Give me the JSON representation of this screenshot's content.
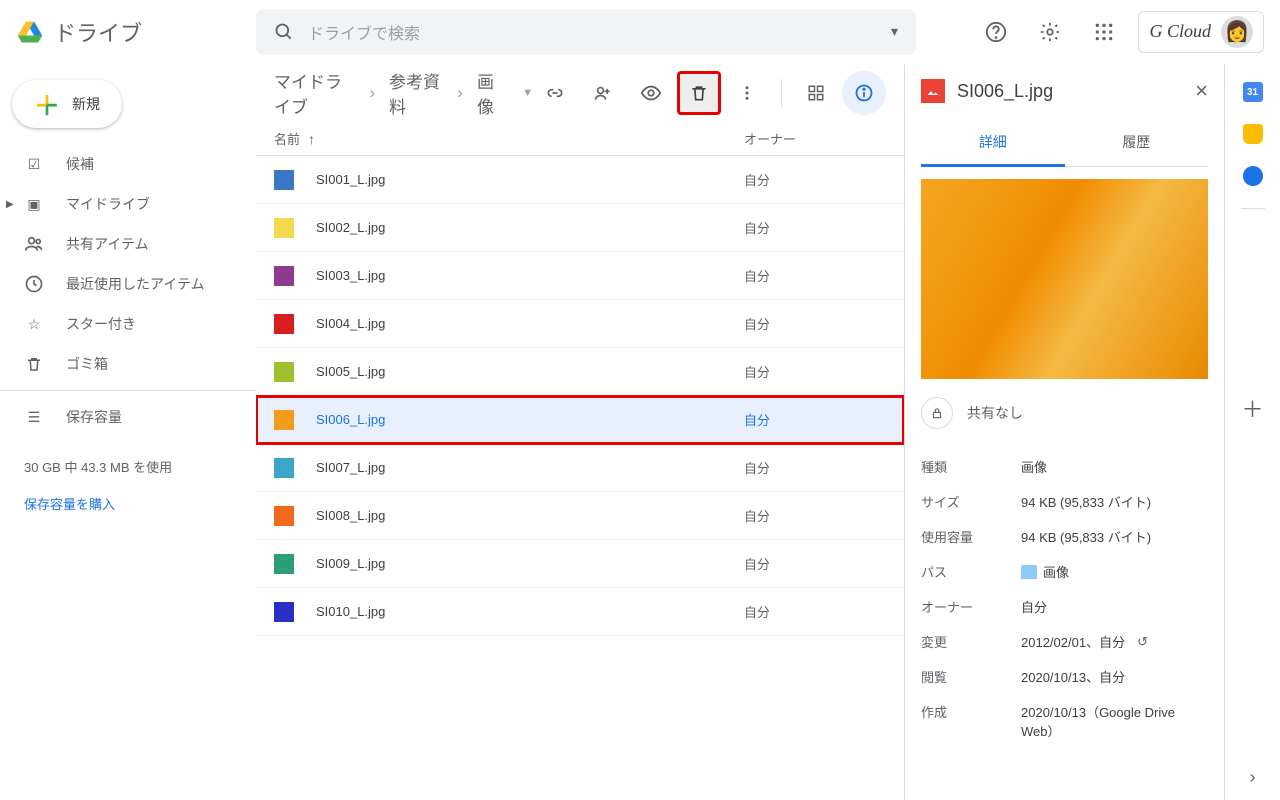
{
  "app_name": "ドライブ",
  "search_placeholder": "ドライブで検索",
  "account_label": "G Cloud",
  "new_button": "新規",
  "nav": {
    "priority": "候補",
    "my_drive": "マイドライブ",
    "shared": "共有アイテム",
    "recent": "最近使用したアイテム",
    "starred": "スター付き",
    "trash": "ゴミ箱",
    "storage": "保存容量",
    "storage_usage": "30 GB 中 43.3 MB を使用",
    "storage_buy": "保存容量を購入"
  },
  "breadcrumb": [
    "マイドライブ",
    "参考資料",
    "画像"
  ],
  "columns": {
    "name": "名前",
    "owner": "オーナー"
  },
  "owner_self": "自分",
  "files": [
    {
      "name": "SI001_L.jpg",
      "color": "#3b78c4"
    },
    {
      "name": "SI002_L.jpg",
      "color": "#f2d94e"
    },
    {
      "name": "SI003_L.jpg",
      "color": "#8e3a8e"
    },
    {
      "name": "SI004_L.jpg",
      "color": "#d81e1e"
    },
    {
      "name": "SI005_L.jpg",
      "color": "#9ebf2e"
    },
    {
      "name": "SI006_L.jpg",
      "color": "#f29b1d",
      "selected": true
    },
    {
      "name": "SI007_L.jpg",
      "color": "#3aa6c9"
    },
    {
      "name": "SI008_L.jpg",
      "color": "#f26a1b"
    },
    {
      "name": "SI009_L.jpg",
      "color": "#2e9e7a"
    },
    {
      "name": "SI010_L.jpg",
      "color": "#2a2fc4"
    }
  ],
  "details": {
    "title": "SI006_L.jpg",
    "tab_details": "詳細",
    "tab_history": "履歴",
    "share_status": "共有なし",
    "meta": {
      "type_k": "種類",
      "type_v": "画像",
      "size_k": "サイズ",
      "size_v": "94 KB (95,833 バイト)",
      "used_k": "使用容量",
      "used_v": "94 KB (95,833 バイト)",
      "path_k": "パス",
      "path_v": "画像",
      "owner_k": "オーナー",
      "owner_v": "自分",
      "modified_k": "変更",
      "modified_v": "2012/02/01、自分",
      "viewed_k": "閲覧",
      "viewed_v": "2020/10/13、自分",
      "created_k": "作成",
      "created_v": "2020/10/13（Google Drive Web）"
    }
  }
}
